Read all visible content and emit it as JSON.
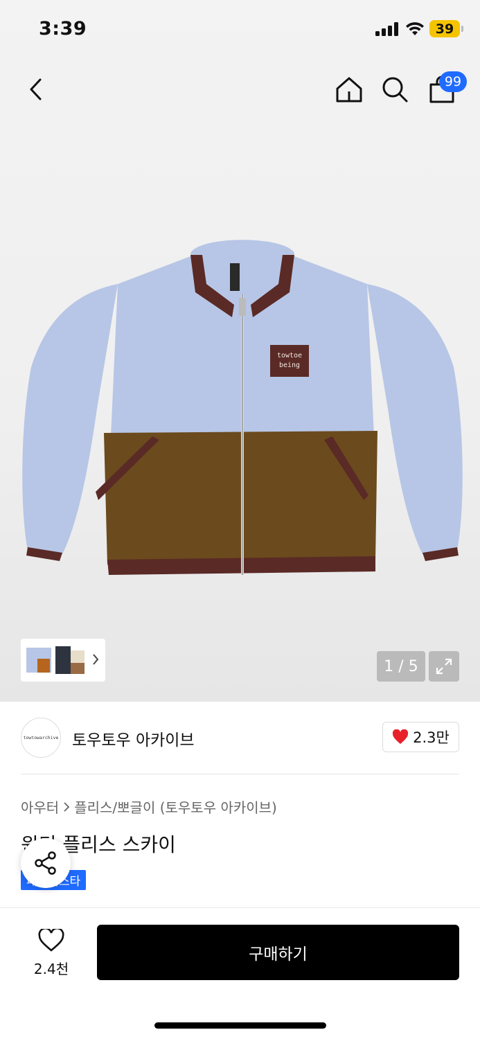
{
  "status_bar": {
    "time": "3:39",
    "battery": "39"
  },
  "nav": {
    "cart_count": "99"
  },
  "gallery": {
    "counter": "1 / 5"
  },
  "jacket_patch": {
    "line1": "towtoe",
    "line2": "being"
  },
  "brand": {
    "logo_text": "towtowarchive",
    "name": "토우토우 아카이브",
    "likes": "2.3만"
  },
  "breadcrumb": {
    "category": "아우터",
    "subcategory": "플리스/뽀글이 (토우토우 아카이브)"
  },
  "product": {
    "title": "윈디 플리스 스카이",
    "tag": "패셔니스타"
  },
  "bottom": {
    "wish_count": "2.4천",
    "buy_label": "구매하기"
  },
  "colors": {
    "accent": "#1f6bff",
    "heart": "#e8202a",
    "sky_fleece": "#b7c6e6",
    "brown_fleece": "#6b4a1d",
    "trim": "#5a2a26"
  }
}
